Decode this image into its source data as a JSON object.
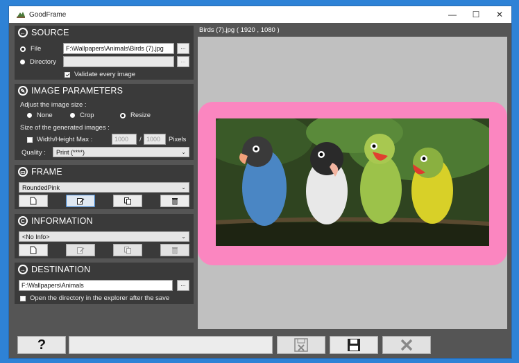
{
  "window": {
    "title": "GoodFrame",
    "minimize": "—",
    "maximize": "☐",
    "close": "✕"
  },
  "source": {
    "heading": "SOURCE",
    "file_label": "File",
    "file_value": "F:\\Wallpapers\\Animals\\Birds (7).jpg",
    "directory_label": "Directory",
    "directory_value": "",
    "browse": "...",
    "validate_label": "Validate every image"
  },
  "image_params": {
    "heading": "IMAGE PARAMETERS",
    "adjust_label": "Adjust the image size :",
    "opt_none": "None",
    "opt_crop": "Crop",
    "opt_resize": "Resize",
    "size_label": "Size of the generated images :",
    "width_height_label": "Width/Height Max :",
    "width_value": "1000",
    "slash": "/",
    "height_value": "1000",
    "pixels": "Pixels",
    "quality_label": "Quality :",
    "quality_value": "Print (****)"
  },
  "frame": {
    "heading": "FRAME",
    "selected": "RoundedPink"
  },
  "information": {
    "heading": "INFORMATION",
    "selected": "<No Info>"
  },
  "destination": {
    "heading": "DESTINATION",
    "path": "F:\\Wallpapers\\Animals",
    "browse": "...",
    "open_dir_label": "Open the directory in the explorer after the save"
  },
  "preview": {
    "caption": "Birds (7).jpg ( 1920 , 1080 )"
  },
  "footer": {
    "help": "?"
  },
  "colors": {
    "frame_pink": "#fb86c0",
    "panel_bg": "#3a3a3a",
    "accent": "#3c7fc8"
  }
}
